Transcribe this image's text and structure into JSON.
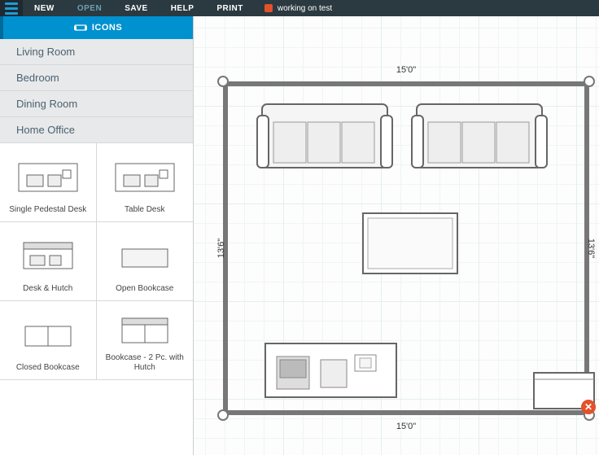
{
  "topbar": {
    "new": "NEW",
    "open": "OPEN",
    "save": "SAVE",
    "help": "HELP",
    "print": "PRINT",
    "status": "working on test"
  },
  "sidebar": {
    "tab_label": "ICONS",
    "categories": [
      "Living Room",
      "Bedroom",
      "Dining Room",
      "Home Office"
    ],
    "items": [
      "Single Pedestal Desk",
      "Table Desk",
      "Desk & Hutch",
      "Open Bookcase",
      "Closed Bookcase",
      "Bookcase - 2 Pc. with Hutch"
    ]
  },
  "room": {
    "width_label": "15'0\"",
    "height_label_left": "13'6\"",
    "height_label_right": "13'6\"",
    "width_label_bottom": "15'0\""
  }
}
